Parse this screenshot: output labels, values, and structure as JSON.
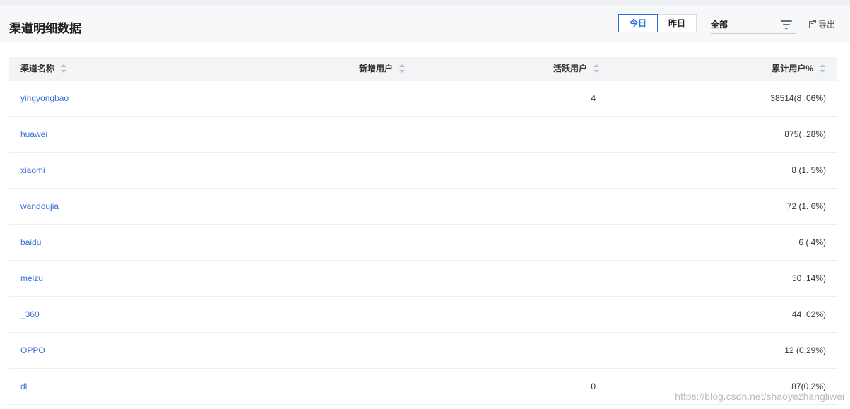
{
  "header": {
    "title": "渠道明细数据",
    "range_tabs": [
      "今日",
      "昨日"
    ],
    "filter_value": "全部",
    "export_label": "导出"
  },
  "table": {
    "columns": [
      "渠道名称",
      "新增用户",
      "活跃用户",
      "累计用户%"
    ],
    "rows": [
      {
        "name": "yingyongbao",
        "new_users": "",
        "active_users": "4",
        "total": "38514(8 .06%)"
      },
      {
        "name": "huawei",
        "new_users": "",
        "active_users": "",
        "total": "875(  .28%)"
      },
      {
        "name": "xiaomi",
        "new_users": "",
        "active_users": "",
        "total": "8  (1. 5%)"
      },
      {
        "name": "wandoujia",
        "new_users": "",
        "active_users": "",
        "total": "72  (1. 6%)"
      },
      {
        "name": "baidu",
        "new_users": "",
        "active_users": "",
        "total": "6  (  4%)"
      },
      {
        "name": "meizu",
        "new_users": "",
        "active_users": "",
        "total": "50  .14%)"
      },
      {
        "name": "_360",
        "new_users": "",
        "active_users": "",
        "total": "44  .02%)"
      },
      {
        "name": "OPPO",
        "new_users": "",
        "active_users": "",
        "total": "12 (0.29%)"
      },
      {
        "name": "dl",
        "new_users": "",
        "active_users": "0",
        "total": "87(0.2%)"
      }
    ]
  },
  "watermark": "https://blog.csdn.net/shaoyezhangliwei",
  "colors": {
    "accent": "#2f6fe0",
    "link": "#3b6fd8",
    "header_bg": "#f7f8fa"
  }
}
